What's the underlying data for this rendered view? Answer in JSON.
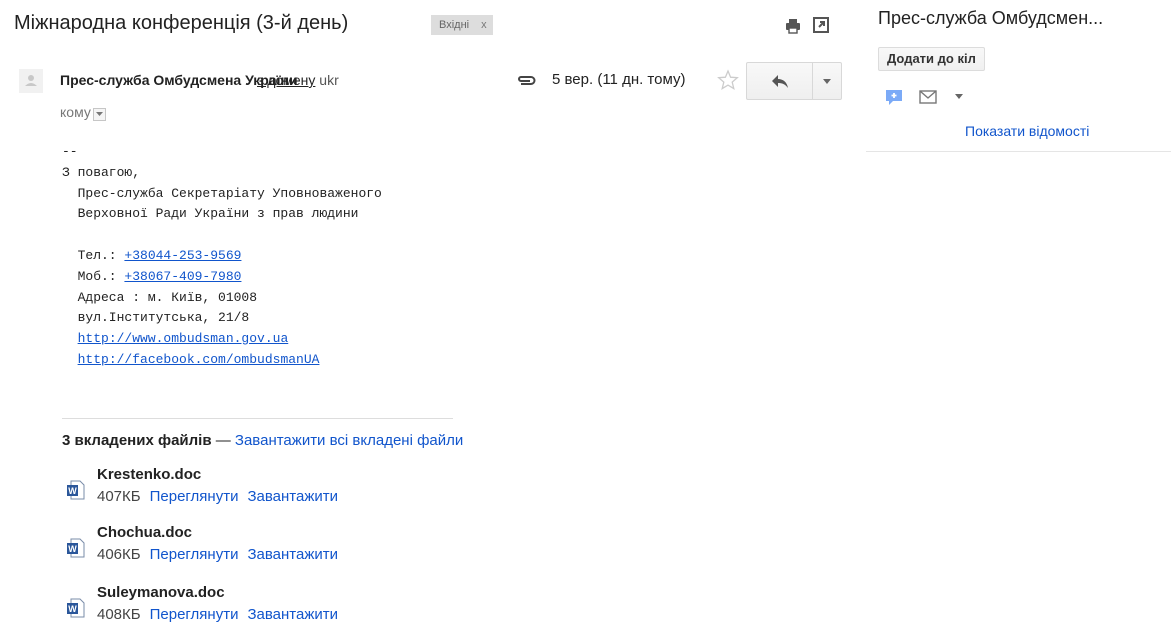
{
  "header": {
    "subject": "Міжнародна конференція (3-й день)",
    "label": "Вхідні",
    "label_remove": "x"
  },
  "message": {
    "sender_name": "Прес-служба Омбудсмена України",
    "via_text": "з домену",
    "via_domain_truncated": "ukr",
    "date": "5 вер. (11 дн. тому)",
    "to_label": "кому",
    "body": {
      "sig_dash": "--",
      "regards": "З повагою,",
      "org_line1": "  Прес-служба Секретаріату Уповноваженого",
      "org_line2": "  Верховної Ради України з прав людини",
      "tel_label": "  Тел.: ",
      "tel": "+38044-253-9569",
      "mob_label": "  Моб.: ",
      "mob": "+38067-409-7980",
      "address1": "  Адреса : м. Київ, 01008",
      "address2": "  вул.Інститутська, 21/8",
      "url1": "http://www.ombudsman.gov.ua",
      "url2": "http://facebook.com/ombudsmanUA"
    }
  },
  "attachments": {
    "header_bold": "3 вкладених файлів",
    "header_sep": " — ",
    "download_all": "Завантажити всі вкладені файли",
    "view_label": "Переглянути",
    "download_label": "Завантажити",
    "files": [
      {
        "name": "Krestenko.doc",
        "size": "407КБ"
      },
      {
        "name": "Chochua.doc",
        "size": "406КБ"
      },
      {
        "name": "Suleymanova.doc",
        "size": "408КБ"
      }
    ]
  },
  "side_panel": {
    "contact_name": "Прес-служба Омбудсмен...",
    "add_to_circles": "Додати до кіл",
    "show_details": "Показати відомості"
  },
  "icons": {
    "print": "print-icon",
    "new_window": "new-window-icon",
    "attachment": "paperclip-icon",
    "star": "star-icon",
    "reply": "reply-icon",
    "more": "chevron-down-icon",
    "chat": "chat-icon",
    "mail": "mail-icon"
  },
  "colors": {
    "link": "#1155cc",
    "label_bg": "#dddddd",
    "word_icon": "#2b579a"
  }
}
